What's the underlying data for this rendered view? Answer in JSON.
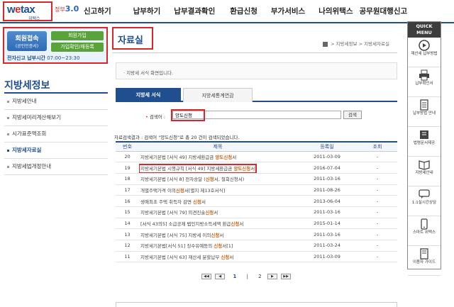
{
  "header": {
    "logo_main_a": "w",
    "logo_main_e": "e",
    "logo_main_b": "tax",
    "logo_sub": "위택스",
    "emblem_a": "정부",
    "emblem_b": "3.0",
    "nav": [
      "신고하기",
      "납부하기",
      "납부결과확인",
      "환급신청",
      "부가서비스",
      "나의위택스",
      "공무원대행신고"
    ]
  },
  "login": {
    "cert_line1": "회원접속",
    "cert_line2": "(공인인증서)",
    "join": "회원가입",
    "find": "가입확인/재등록",
    "hours_label": "전자신고 납부시간",
    "hours_value": "07:00~23:30"
  },
  "sidebar": {
    "title": "지방세정보",
    "items": [
      {
        "label": "지방세안내",
        "active": false
      },
      {
        "label": "지방세미리계산해보기",
        "active": false
      },
      {
        "label": "시가표준액조회",
        "active": false
      },
      {
        "label": "지방세자료실",
        "active": true
      },
      {
        "label": "지방세법개정안내",
        "active": false
      }
    ]
  },
  "main": {
    "title": "자료실",
    "breadcrumb": [
      "지방세정보",
      "지방세자료실"
    ],
    "desc": "· 지방세 서식 화면입니다.",
    "tabs": [
      "지방세 서식",
      "지방세통계연감"
    ],
    "search": {
      "label": "검색어 :",
      "value": "양도신청",
      "button": "검색"
    },
    "result": "자료검색결과 : 검색어 \"양도신청\"로 총 20 건이 검색되었습니다.",
    "table": {
      "headers": [
        "번호",
        "제목",
        "등록일",
        "조회"
      ],
      "rows": [
        {
          "no": "20",
          "pre": "지방세기본법 [서식 49] 지방세환급금 ",
          "hl": "양도신청",
          "post": "서",
          "date": "2011-03-09",
          "views": "-",
          "marked": false
        },
        {
          "no": "19",
          "pre": "지방세기본법 시행규칙 [서식 49] 지방세환급금 ",
          "hl": "양도신청",
          "post": "서",
          "date": "2016-07-04",
          "views": "-",
          "marked": true
        },
        {
          "no": "18",
          "pre": "지방세기본법 [서식 8] 전자송달 (",
          "hl": "신청",
          "post": "서, 철회신청서)",
          "date": "2011-03-16",
          "views": "-",
          "marked": false
        },
        {
          "no": "17",
          "pre": "개별주택가격 이의",
          "hl": "신청",
          "post": "서[별지 제13호서식]",
          "date": "2011-08-26",
          "views": "-",
          "marked": false
        },
        {
          "no": "16",
          "pre": "생애최초 주택 취득자 감면 ",
          "hl": "신청",
          "post": "서",
          "date": "2013-06-04",
          "views": "-",
          "marked": false
        },
        {
          "no": "15",
          "pre": "지방세기본법 [서식 79] 의견진술",
          "hl": "신청",
          "post": "서",
          "date": "2011-03-16",
          "views": "-",
          "marked": false
        },
        {
          "no": "14",
          "pre": "[서식 43의5] 소급공제 법인지방소득세액 환급",
          "hl": "신청",
          "post": "서",
          "date": "2015-01-14",
          "views": "-",
          "marked": false
        },
        {
          "no": "13",
          "pre": "지방세기본법 [서식 75] 지방세 이의",
          "hl": "신청",
          "post": "서",
          "date": "2011-03-16",
          "views": "-",
          "marked": false
        },
        {
          "no": "12",
          "pre": "지방세기본법[서식 51] 징수유예등의 ",
          "hl": "신청",
          "post": "서[1]",
          "date": "2011-03-24",
          "views": "-",
          "marked": false
        },
        {
          "no": "11",
          "pre": "지방세기본법 [서식 63] 재산세 분할납부 ",
          "hl": "신청",
          "post": "서",
          "date": "2011-03-09",
          "views": "-",
          "marked": false
        }
      ]
    },
    "pager": {
      "first": "◀◀",
      "prev": "◀",
      "pages": [
        "1",
        "2"
      ],
      "current": "1",
      "next": "▶",
      "last": "▶▶"
    }
  },
  "quick": {
    "head": [
      "QUICK",
      "MENU"
    ],
    "items": [
      {
        "label": "재산세 납부방법",
        "icon": "play-icon"
      },
      {
        "label": "납부확인서",
        "icon": "printer-icon"
      },
      {
        "label": "납부방법 안내",
        "icon": "document-icon"
      },
      {
        "label": "법령문서제공",
        "icon": "book-icon"
      },
      {
        "label": "지방세안내",
        "icon": "book-open-icon"
      },
      {
        "label": "1:1실시간상담",
        "icon": "chat-icon"
      },
      {
        "label": "스마트 위택스",
        "icon": "phone-icon"
      },
      {
        "label": "이용자 가이드",
        "icon": "guide-icon"
      }
    ]
  },
  "colors": {
    "brand": "#1f4f8f",
    "highlight_box": "#d9262c",
    "keyword": "#c8671c"
  }
}
